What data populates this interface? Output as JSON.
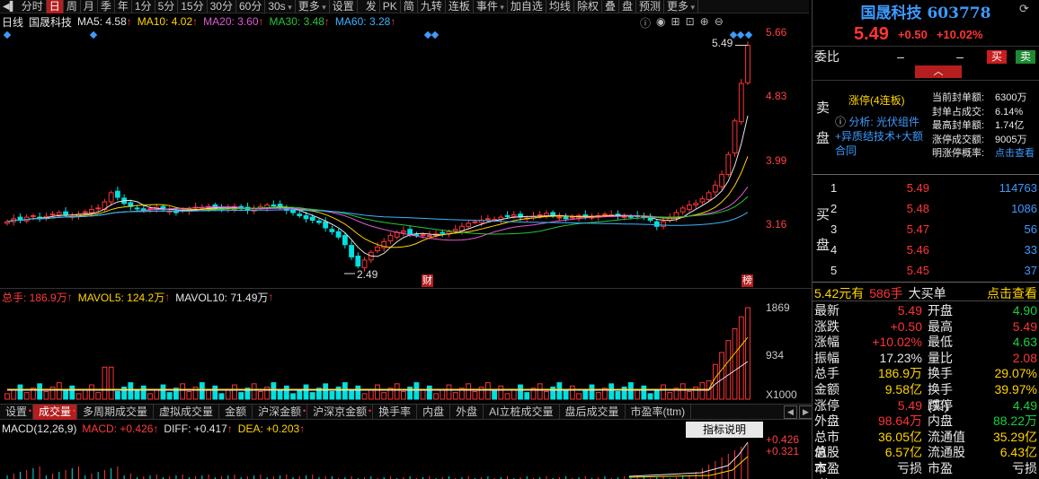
{
  "toolbar": {
    "items": [
      "分时",
      "日",
      "周",
      "月",
      "季",
      "年",
      "1分",
      "5分",
      "15分",
      "30分",
      "60分",
      "30s",
      "更多",
      "设置"
    ],
    "active": "日",
    "right_items": [
      "发",
      "PK",
      "简",
      "九转",
      "连板",
      "事件",
      "加自选",
      "均线",
      "除权",
      "叠",
      "盘",
      "预测",
      "更多"
    ]
  },
  "kline": {
    "period_label": "日线",
    "stock_name": "国晟科技",
    "ma": [
      {
        "name": "MA5",
        "value": "4.58",
        "color": "#e6e6e6"
      },
      {
        "name": "MA10",
        "value": "4.02",
        "color": "#ffd400"
      },
      {
        "name": "MA20",
        "value": "3.60",
        "color": "#e05ad6"
      },
      {
        "name": "MA30",
        "value": "3.48",
        "color": "#25c63a"
      },
      {
        "name": "MA60",
        "value": "3.28",
        "color": "#3cb4ff"
      }
    ],
    "y_ticks": [
      "5.66",
      "4.83",
      "3.99",
      "3.16"
    ],
    "high_label": "5.49",
    "low_label": "2.49",
    "marker_cai": "财",
    "marker_bang": "榜"
  },
  "volume": {
    "title": "总手: 186.9万",
    "mavol5": "MAVOL5: 124.2万",
    "mavol10": "MAVOL10: 71.49万",
    "y_ticks": [
      "1869",
      "934"
    ],
    "unit": "X1000"
  },
  "indicator_tabs": [
    "设置",
    "成交量",
    "多周期成交量",
    "虚拟成交量",
    "金额",
    "沪深金额",
    "沪深京金额",
    "换手率",
    "内盘",
    "外盘",
    "AI立桩成交量",
    "盘后成交量",
    "市盈率(ttm)"
  ],
  "indicator_active": "成交量",
  "macd": {
    "title": "MACD(12,26,9)",
    "macd": "MACD: +0.426",
    "diff": "DIFF: +0.417",
    "dea": "DEA: +0.203",
    "y_ticks": [
      "+0.426",
      "+0.321"
    ],
    "help": "指标说明"
  },
  "stock": {
    "name_code": "国晟科技 603778",
    "price": "5.49",
    "change": "+0.50",
    "change_pct": "+10.02%"
  },
  "order": {
    "weibi_label": "委比",
    "weibi_val1": "–",
    "weibi_val2": "–",
    "buy_btn": "买",
    "sell_btn": "卖",
    "sell_side_label": "卖盘",
    "limit_status": "涨停(4连板)",
    "analysis": "分析: 光伏组件+异质结技术+大额合同",
    "seal_labels": [
      "当前封单额:",
      "封单占成交:",
      "最高封单额:",
      "涨停成交额:",
      "明涨停概率:"
    ],
    "seal_values": [
      "6300万",
      "6.14%",
      "1.74亿",
      "9005万",
      "点击查看"
    ],
    "buy_side_label": "买盘",
    "bids": [
      {
        "level": "1",
        "price": "5.49",
        "vol": "114763"
      },
      {
        "level": "2",
        "price": "5.48",
        "vol": "1086"
      },
      {
        "level": "3",
        "price": "5.47",
        "vol": "56"
      },
      {
        "level": "4",
        "price": "5.46",
        "vol": "33"
      },
      {
        "level": "5",
        "price": "5.45",
        "vol": "37"
      }
    ],
    "big_order_price": "5.42元有",
    "big_order_vol": "586手",
    "big_order_text": "大买单",
    "big_order_link": "点击查看"
  },
  "quote": [
    {
      "l": "最新",
      "lv": "5.49",
      "lc": "#ff3434",
      "r": "开盘",
      "rv": "4.90",
      "rc": "#17d13c"
    },
    {
      "l": "涨跌",
      "lv": "+0.50",
      "lc": "#ff3434",
      "r": "最高",
      "rv": "5.49",
      "rc": "#ff3434"
    },
    {
      "l": "涨幅",
      "lv": "+10.02%",
      "lc": "#ff3434",
      "r": "最低",
      "rv": "4.63",
      "rc": "#17d13c"
    },
    {
      "l": "振幅",
      "lv": "17.23%",
      "lc": "#e8e8e8",
      "r": "量比",
      "rv": "2.08",
      "rc": "#ff3434"
    },
    {
      "l": "总手",
      "lv": "186.9万",
      "lc": "#ffd400",
      "r": "换手",
      "rv": "29.07%",
      "rc": "#ffd400"
    },
    {
      "l": "金额",
      "lv": "9.58亿",
      "lc": "#ffd400",
      "r": "换手(实)",
      "rv": "39.97%",
      "rc": "#ffd400"
    },
    {
      "l": "涨停",
      "lv": "5.49",
      "lc": "#ff3434",
      "r": "跌停",
      "rv": "4.49",
      "rc": "#17d13c"
    },
    {
      "l": "外盘",
      "lv": "98.64万",
      "lc": "#ff3434",
      "r": "内盘",
      "rv": "88.22万",
      "rc": "#17d13c"
    },
    {
      "l": "总市值",
      "lv": "36.05亿",
      "lc": "#ffd400",
      "r": "流通值",
      "rv": "35.29亿",
      "rc": "#ffd400"
    },
    {
      "l": "总股本",
      "lv": "6.57亿",
      "lc": "#ffd400",
      "r": "流通股",
      "rv": "6.43亿",
      "rc": "#ffd400"
    },
    {
      "l": "市盈(静)",
      "lv": "亏损",
      "lc": "#e8e8e8",
      "r": "市盈(TTM)",
      "rv": "亏损",
      "rc": "#e8e8e8"
    }
  ],
  "colors": {
    "up": "#ff3434",
    "down": "#00e0e0",
    "accent": "#b41e1e"
  }
}
